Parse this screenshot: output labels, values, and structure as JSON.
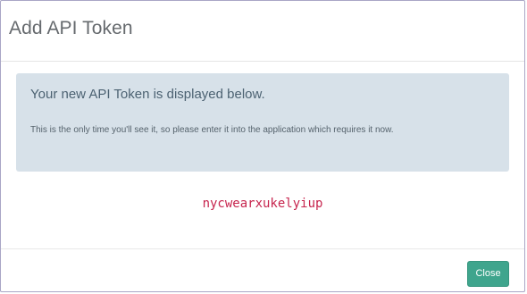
{
  "modal": {
    "title": "Add API Token"
  },
  "alert": {
    "heading": "Your new API Token is displayed below.",
    "body": "This is the only time you'll see it, so please enter it into the application which requires it now."
  },
  "token": {
    "value": "nycwearxukelyiup"
  },
  "footer": {
    "close_label": "Close"
  },
  "colors": {
    "alert_background": "#d7e1e9",
    "token_text": "#c7254e",
    "close_button": "#3fa58d",
    "modal_border": "#a9a6c6"
  }
}
